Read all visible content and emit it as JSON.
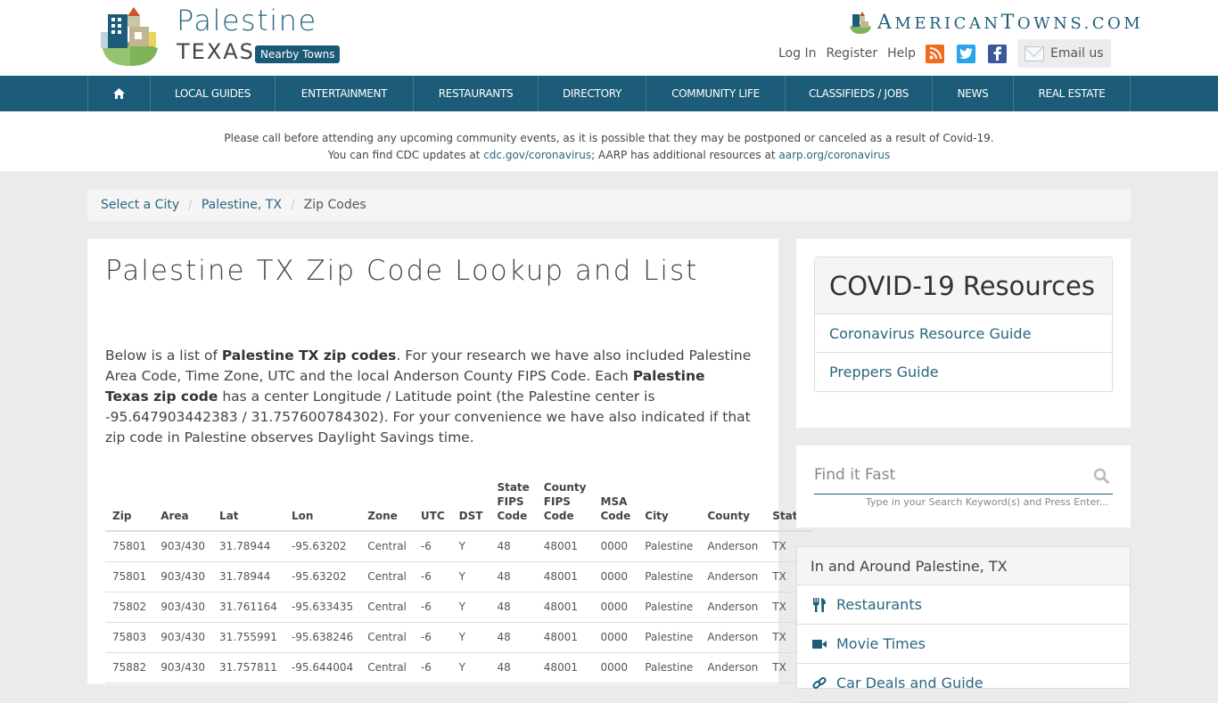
{
  "header": {
    "city": "Palestine",
    "state": "TEXAS",
    "nearby_label": "Nearby Towns",
    "brand_initial_a": "A",
    "brand_mid": "MERICAN",
    "brand_initial_t": "T",
    "brand_end": "OWNS.COM",
    "links": {
      "login": "Log In",
      "register": "Register",
      "help": "Help"
    },
    "email_label": "Email us"
  },
  "nav": {
    "items": [
      "LOCAL GUIDES",
      "ENTERTAINMENT",
      "RESTAURANTS",
      "DIRECTORY",
      "COMMUNITY LIFE",
      "CLASSIFIEDS / JOBS",
      "NEWS",
      "REAL ESTATE"
    ]
  },
  "notice": {
    "line1": "Please call before attending any upcoming community events, as it is possible that they may be postponed or canceled as a result of Covid-19.",
    "line2_prefix": "You can find CDC updates at ",
    "cdc_link": "cdc.gov/coronavirus",
    "line2_mid": "; AARP has additional resources at ",
    "aarp_link": "aarp.org/coronavirus"
  },
  "breadcrumb": {
    "items": [
      "Select a City",
      "Palestine, TX",
      "Zip Codes"
    ],
    "separator": "/"
  },
  "main": {
    "title": "Palestine TX Zip Code Lookup and List",
    "intro": {
      "p1": "Below is a list of ",
      "b1": "Palestine TX zip codes",
      "p2": ". For your research we have also included Palestine Area Code, Time Zone, UTC and the local Anderson County FIPS Code. Each ",
      "b2": "Palestine Texas zip code",
      "p3": " has a center Longitude / Latitude point (the Palestine center is -95.647903442383 / 31.757600784302). For your convenience we have also indicated if that zip code in Palestine observes Daylight Savings time."
    },
    "table": {
      "headers": [
        "Zip",
        "Area",
        "Lat",
        "Lon",
        "Zone",
        "UTC",
        "DST",
        "State FIPS Code",
        "County FIPS Code",
        "MSA Code",
        "City",
        "County",
        "State"
      ],
      "rows": [
        [
          "75801",
          "903/430",
          "31.78944",
          "-95.63202",
          "Central",
          "-6",
          "Y",
          "48",
          "48001",
          "0000",
          "Palestine",
          "Anderson",
          "TX"
        ],
        [
          "75801",
          "903/430",
          "31.78944",
          "-95.63202",
          "Central",
          "-6",
          "Y",
          "48",
          "48001",
          "0000",
          "Palestine",
          "Anderson",
          "TX"
        ],
        [
          "75802",
          "903/430",
          "31.761164",
          "-95.633435",
          "Central",
          "-6",
          "Y",
          "48",
          "48001",
          "0000",
          "Palestine",
          "Anderson",
          "TX"
        ],
        [
          "75803",
          "903/430",
          "31.755991",
          "-95.638246",
          "Central",
          "-6",
          "Y",
          "48",
          "48001",
          "0000",
          "Palestine",
          "Anderson",
          "TX"
        ],
        [
          "75882",
          "903/430",
          "31.757811",
          "-95.644004",
          "Central",
          "-6",
          "Y",
          "48",
          "48001",
          "0000",
          "Palestine",
          "Anderson",
          "TX"
        ]
      ]
    }
  },
  "sidebar": {
    "covid": {
      "title": "COVID-19 Resources",
      "links": [
        "Coronavirus Resource Guide",
        "Preppers Guide"
      ]
    },
    "search": {
      "placeholder": "Find it Fast",
      "value": "",
      "hint": "Type in your Search Keyword(s) and Press Enter..."
    },
    "around": {
      "title": "In and Around Palestine, TX",
      "items": [
        {
          "label": "Restaurants",
          "icon": "utensils-icon"
        },
        {
          "label": "Movie Times",
          "icon": "video-camera-icon"
        },
        {
          "label": "Car Deals and Guide",
          "icon": "link-icon"
        }
      ]
    }
  },
  "colors": {
    "brand": "#1c5c78",
    "link": "#2a6680",
    "rss": "#f26b1d",
    "twitter": "#2aa3ef",
    "facebook": "#3b5998"
  }
}
